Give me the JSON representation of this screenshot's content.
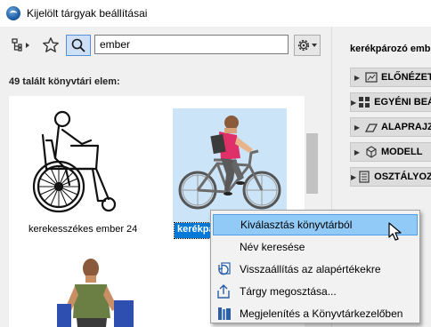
{
  "window": {
    "title": "Kijelölt tárgyak beállításai"
  },
  "toolbar": {
    "search_value": "ember",
    "icons": [
      "tree-view-icon",
      "star-icon",
      "search-icon",
      "settings-gear-icon"
    ]
  },
  "results": {
    "count_label": "49 talált könyvtári elem:",
    "items": [
      {
        "label": "kerekesszékes ember 24",
        "icon": "wheelchair-person-thumbnail",
        "selected": false
      },
      {
        "label": "kerékpározó ember",
        "icon": "cyclist-thumbnail",
        "selected": true
      },
      {
        "label": "",
        "icon": "seated-person-thumbnail",
        "selected": false
      }
    ]
  },
  "right_panel": {
    "title": "kerékpározó ember",
    "sections": [
      {
        "label": "ELŐNÉZET",
        "icon": "preview-icon"
      },
      {
        "label": "EGYÉNI BEÁLLÍTÁSOK",
        "icon": "custom-settings-icon"
      },
      {
        "label": "ALAPRAJZ",
        "icon": "floor-plan-icon"
      },
      {
        "label": "MODELL",
        "icon": "model-cube-icon"
      },
      {
        "label": "OSZTÁLYOZÁS",
        "icon": "classification-icon"
      }
    ]
  },
  "context_menu": {
    "items": [
      {
        "label": "Kiválasztás könyvtárból",
        "icon": "",
        "highlighted": true
      },
      {
        "label": "Név keresése",
        "icon": "",
        "highlighted": false
      },
      {
        "label": "Visszaállítás az alapértékekre",
        "icon": "reset-icon",
        "highlighted": false
      },
      {
        "label": "Tárgy megosztása...",
        "icon": "share-icon",
        "highlighted": false
      },
      {
        "label": "Megjelenítés a Könyvtárkezelőben",
        "icon": "library-manager-icon",
        "highlighted": false
      }
    ]
  },
  "colors": {
    "selection": "#0078d7",
    "menu_highlight": "#91c9f7",
    "thumbnail_selected_bg": "#cce4f7"
  }
}
